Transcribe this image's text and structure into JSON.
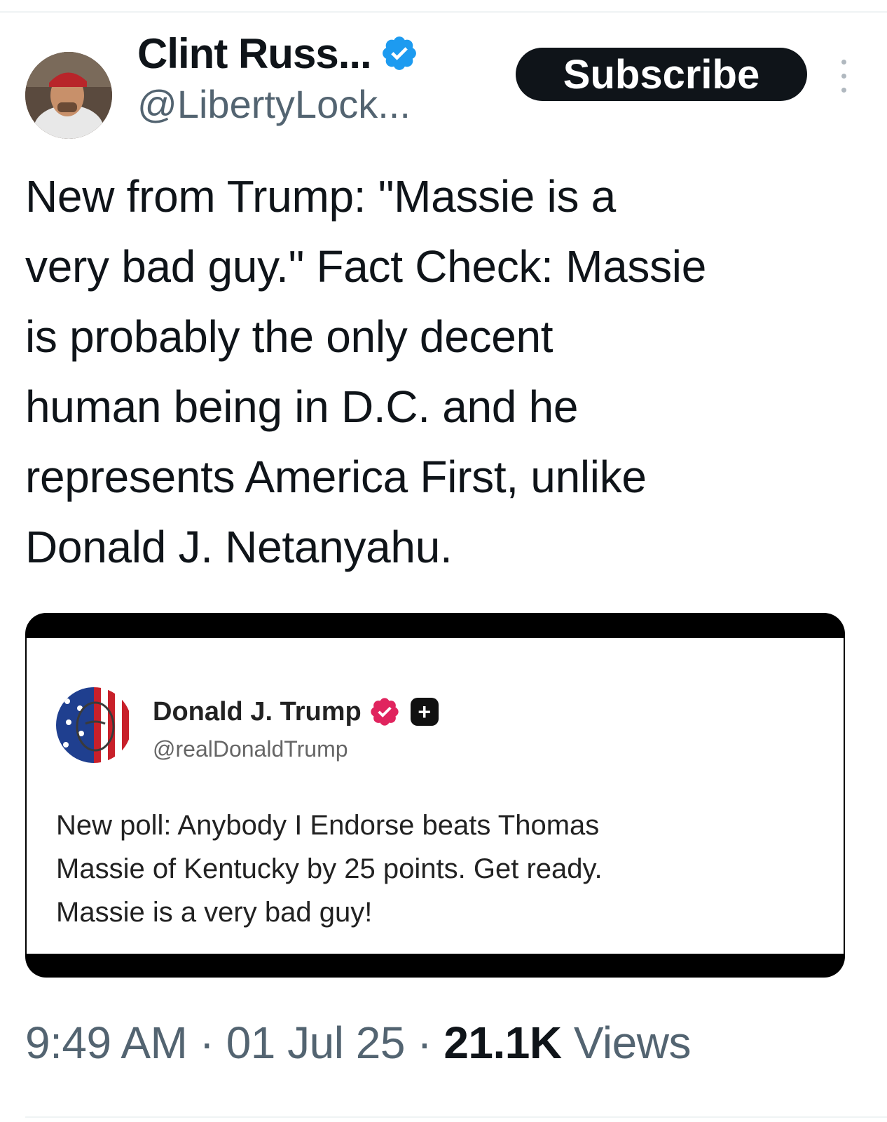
{
  "author": {
    "display_name": "Clint Russ...",
    "handle": "@LibertyLock...",
    "verified_color": "#1d9bf0"
  },
  "actions": {
    "subscribe_label": "Subscribe",
    "more_icon": "more-vertical-icon"
  },
  "tweet": {
    "text": "New from Trump: \"Massie is a\nvery bad guy.\" Fact Check: Massie\nis probably the only decent\nhuman being in D.C. and he\nrepresents America First, unlike\nDonald J. Netanyahu."
  },
  "quoted_post": {
    "display_name": "Donald J. Trump",
    "handle": "@realDonaldTrump",
    "badge_color": "#e0245e",
    "text": "New poll: Anybody I Endorse beats Thomas\nMassie of Kentucky by 25 points. Get ready.\nMassie is a very bad guy!"
  },
  "meta": {
    "time": "9:49 AM",
    "separator": "·",
    "date": "01 Jul 25",
    "views_count": "21.1K",
    "views_label": "Views"
  }
}
